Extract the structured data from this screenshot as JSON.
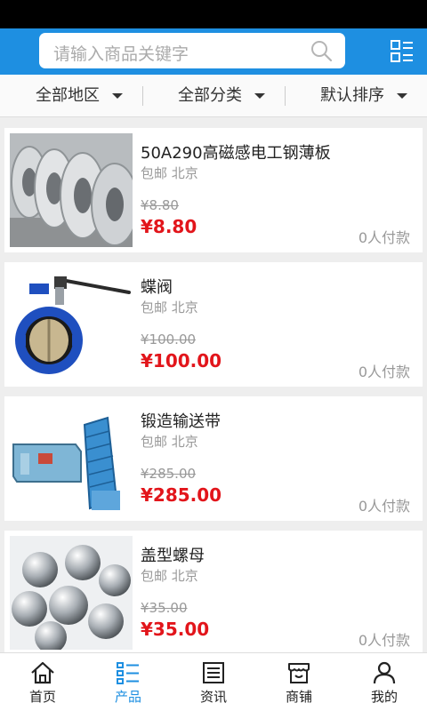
{
  "search": {
    "placeholder": "请输入商品关键字"
  },
  "filters": [
    {
      "label": "全部地区"
    },
    {
      "label": "全部分类"
    },
    {
      "label": "默认排序"
    }
  ],
  "products": [
    {
      "title": "50A290高磁感电工钢薄板",
      "subtitle": "包邮 北京",
      "original_price": "¥8.80",
      "price": "¥8.80",
      "buyers": "0人付款",
      "image": "steel-coils-image"
    },
    {
      "title": "蝶阀",
      "subtitle": "包邮 北京",
      "original_price": "¥100.00",
      "price": "¥100.00",
      "buyers": "0人付款",
      "image": "butterfly-valve-image"
    },
    {
      "title": "锻造输送带",
      "subtitle": "包邮 北京",
      "original_price": "¥285.00",
      "price": "¥285.00",
      "buyers": "0人付款",
      "image": "conveyor-belt-image"
    },
    {
      "title": "盖型螺母",
      "subtitle": "包邮 北京",
      "original_price": "¥35.00",
      "price": "¥35.00",
      "buyers": "0人付款",
      "image": "cap-nuts-image"
    }
  ],
  "nav": [
    {
      "label": "首页",
      "icon": "home-icon",
      "active": false
    },
    {
      "label": "产品",
      "icon": "product-list-icon",
      "active": true
    },
    {
      "label": "资讯",
      "icon": "news-icon",
      "active": false
    },
    {
      "label": "商铺",
      "icon": "shop-icon",
      "active": false
    },
    {
      "label": "我的",
      "icon": "user-icon",
      "active": false
    }
  ],
  "colors": {
    "brand": "#1e8fe1",
    "price": "#e2151b",
    "muted": "#999999"
  }
}
